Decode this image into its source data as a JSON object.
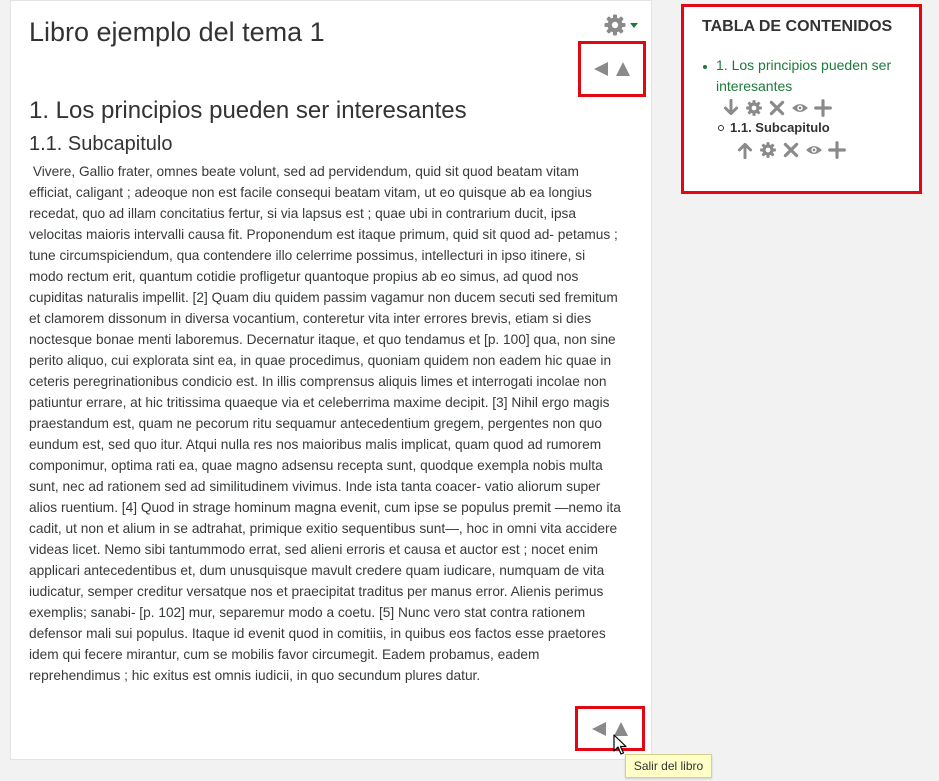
{
  "book": {
    "title": "Libro ejemplo del tema 1",
    "chapter_title": "1. Los principios pueden ser interesantes",
    "subchapter_title": "1.1. Subcapitulo",
    "body_text": " Vivere, Gallio frater, omnes beate volunt, sed ad pervidendum, quid sit quod beatam vitam\nefficiat, caligant ; adeoque non est facile consequi beatam vitam, ut eo quisque ab ea longius\nrecedat, quo ad illam concitatius fertur, si via lapsus est ; quae ubi in contrarium ducit, ipsa\nvelocitas maioris intervalli causa fit. Proponendum est itaque primum, quid sit quod ad- petamus ;\ntune circumspiciendum, qua contendere illo celerrime possimus, intellecturi in ipso itinere, si\nmodo rectum erit, quantum cotidie profligetur quantoque propius ab eo simus, ad quod nos\ncupiditas naturalis impellit. [2] Quam diu quidem passim vagamur non ducem secuti sed fremitum\net clamorem dissonum in diversa vocantium, conteretur vita inter errores brevis, etiam si dies\nnoctesque bonae menti laboremus. Decernatur itaque, et quo tendamus et [p. 100] qua, non sine\nperito aliquo, cui explorata sint ea, in quae procedimus, quoniam quidem non eadem hic quae in\nceteris peregrinationibus condicio est. In illis comprensus aliquis limes et interrogati incolae non\npatiuntur errare, at hic tritissima quaeque via et celeberrima maxime decipit. [3] Nihil ergo magis\npraestandum est, quam ne pecorum ritu sequamur antecedentium gregem, pergentes non quo\neundum est, sed quo itur. Atqui nulla res nos maioribus malis implicat, quam quod ad rumorem\ncomponimur, optima rati ea, quae magno adsensu recepta sunt, quodque exempla nobis multa\nsunt, nec ad rationem sed ad similitudinem vivimus. Inde ista tanta coacer- vatio aliorum super\nalios ruentium. [4] Quod in strage hominum magna evenit, cum ipse se populus premit —nemo ita\ncadit, ut non et alium in se adtrahat, primique exitio sequentibus sunt—, hoc in omni vita accidere\nvideas licet. Nemo sibi tantummodo errat, sed alieni erroris et causa et auctor est ; nocet enim\napplicari antecedentibus et, dum unusquisque mavult credere quam iudicare, numquam de vita\niudicatur, semper creditur versatque nos et praecipitat traditus per manus error. Alienis perimus\nexemplis; sanabi- [p. 102] mur, separemur modo a coetu. [5] Nunc vero stat contra rationem\ndefensor mali sui populus. Itaque id evenit quod in comitiis, in quibus eos factos esse praetores\nidem qui fecere mirantur, cum se mobilis favor circumegit. Eadem probamus, eadem\nreprehendimus ; hic exitus est omnis iudicii, in quo secundum plures datur."
  },
  "tooltip": "Salir del libro",
  "toc": {
    "heading": "TABLA DE CONTENIDOS",
    "chapters": [
      {
        "label": "1. Los principios pueden ser interesantes",
        "actions": [
          "arrow-down-icon",
          "gear-icon",
          "close-icon",
          "eye-icon",
          "plus-icon"
        ]
      },
      {
        "label": "1.1. Subcapitulo",
        "actions": [
          "arrow-up-icon",
          "gear-icon",
          "close-icon",
          "eye-icon",
          "plus-icon"
        ]
      }
    ]
  },
  "colors": {
    "link": "#1b7a3a",
    "highlight_border": "#e30613",
    "icon": "#8a8a8a",
    "tooltip_bg": "#ffffc8"
  }
}
